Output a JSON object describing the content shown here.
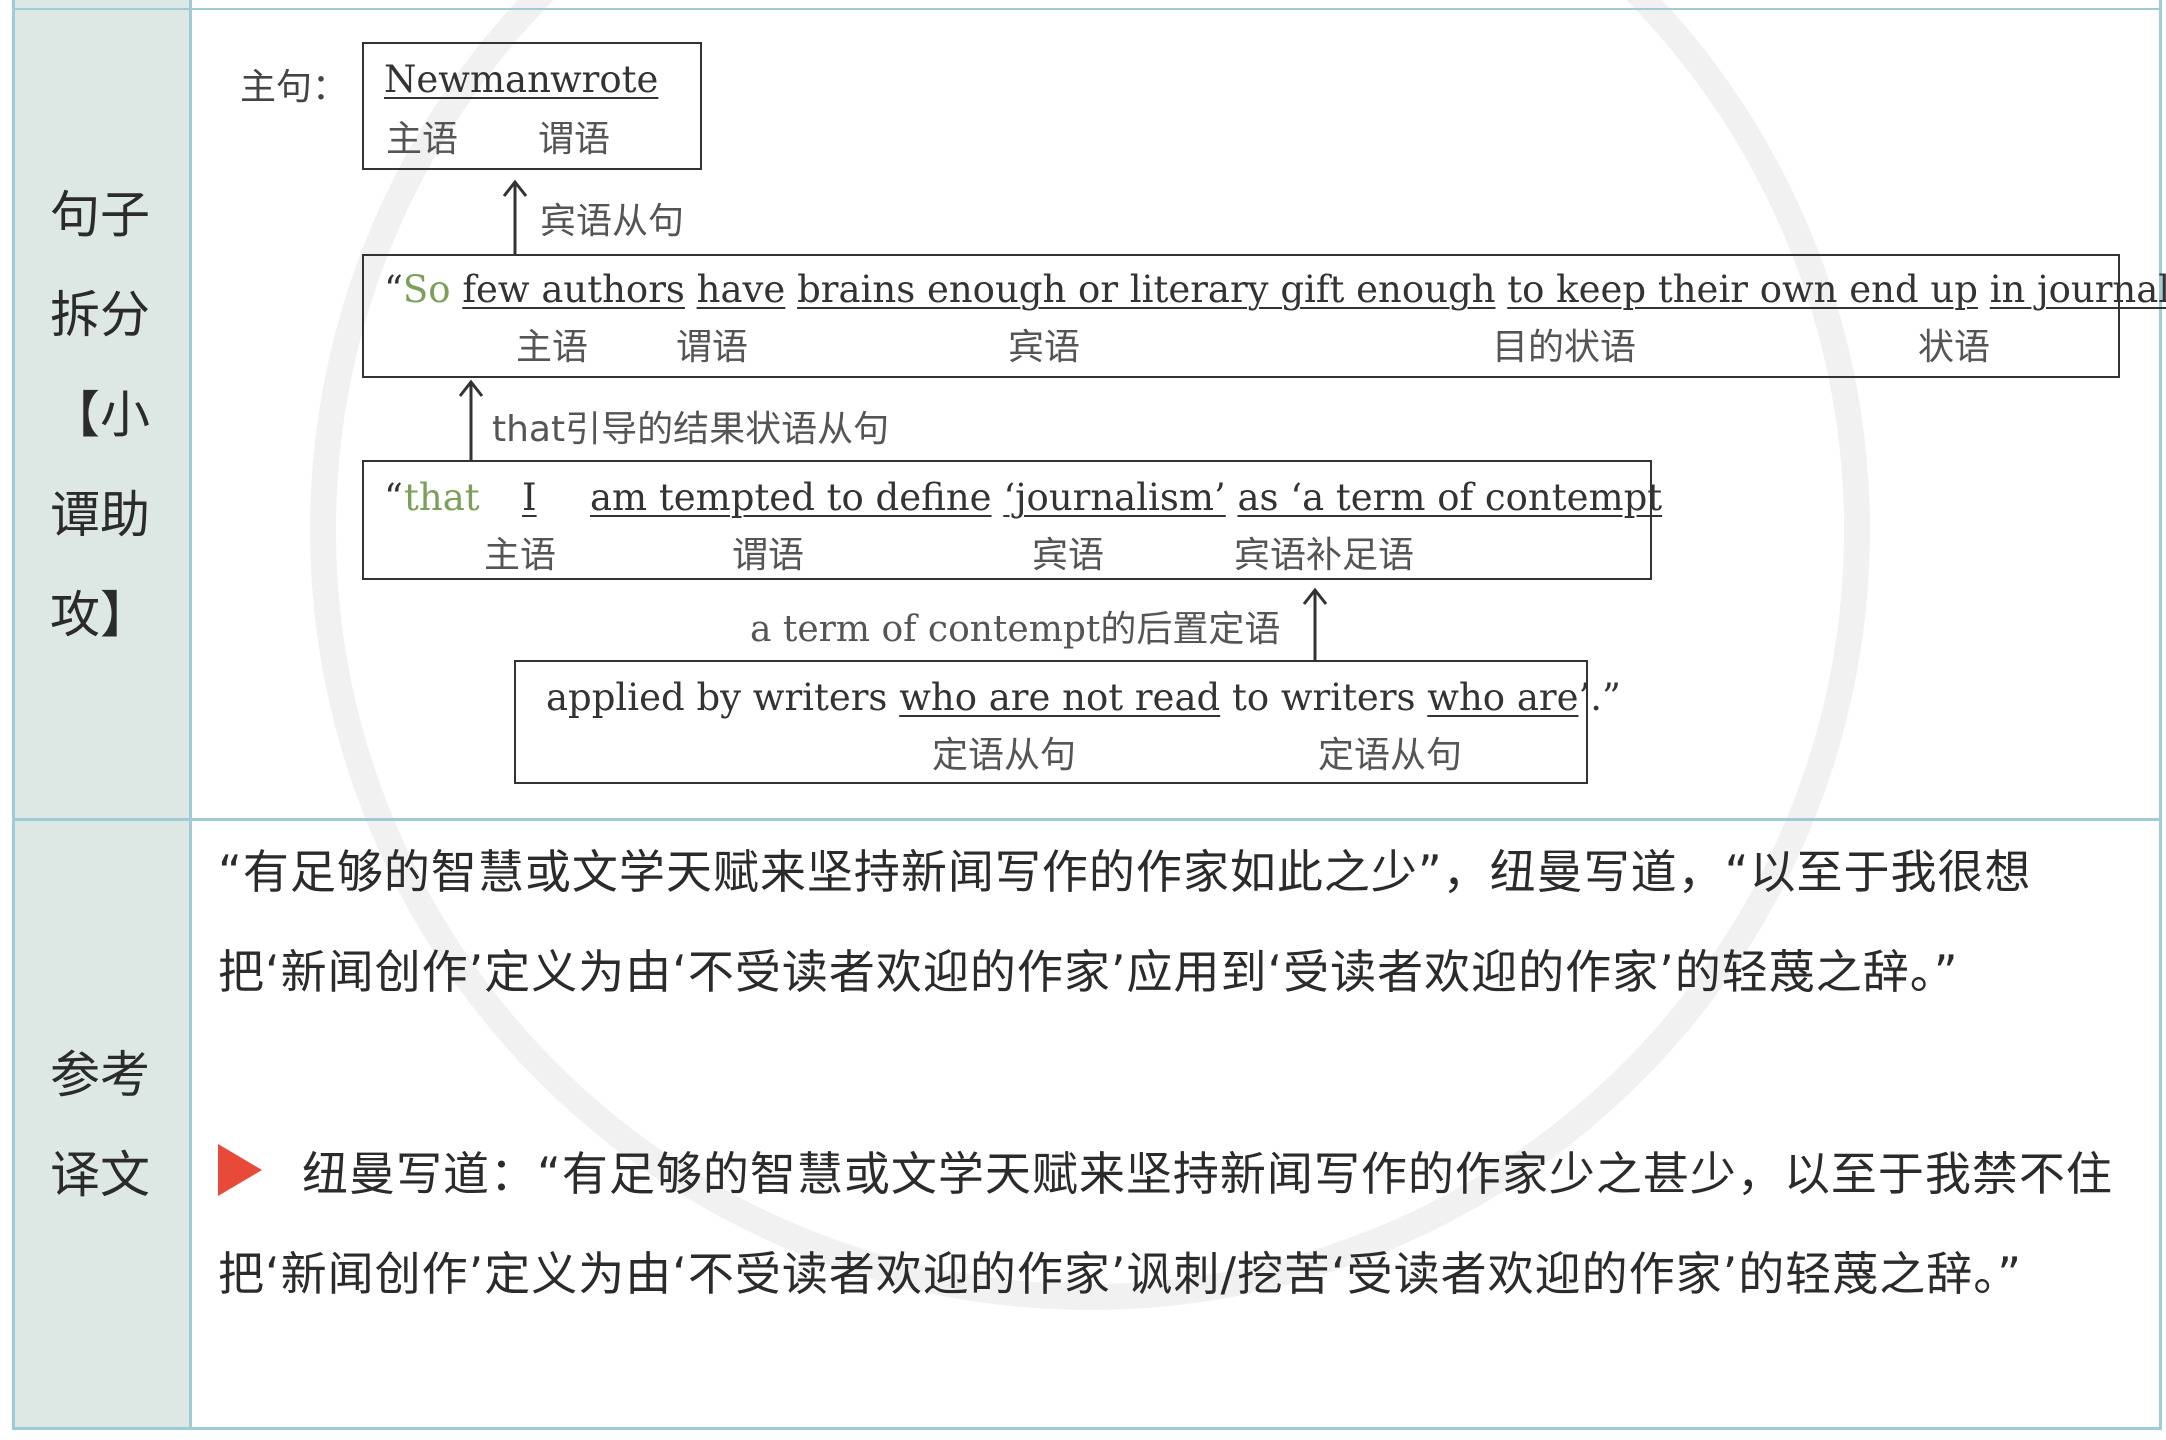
{
  "labels": {
    "analysis": [
      "句子",
      "拆分",
      "【小",
      "谭助",
      "攻】"
    ],
    "translation": [
      "参考",
      "译文"
    ]
  },
  "main_clause": {
    "prefix": "主句：",
    "subject": "Newman",
    "verb": "wrote",
    "subject_tag": "主语",
    "verb_tag": "谓语"
  },
  "arrow1_label": "宾语从句",
  "clause1": {
    "open_quote": "“",
    "so": "So",
    "subject": "few authors",
    "verb": "have",
    "object": "brains enough or literary gift enough",
    "purpose": "to keep their own end up",
    "adverbial": "in  journalism",
    "close": ",”",
    "tags": [
      "主语",
      "谓语",
      "宾语",
      "目的状语",
      "状语"
    ]
  },
  "arrow2_label": "that引导的结果状语从句",
  "clause2": {
    "open_quote": "“",
    "that": "that",
    "subject": "I",
    "verb": "am tempted to define",
    "object": "‘journalism’",
    "complement": "as ‘a term of contempt",
    "tags": [
      "主语",
      "谓语",
      "宾语",
      "宾语补足语"
    ]
  },
  "arrow3_label": "a term of contempt的后置定语",
  "clause3": {
    "t1": "applied by writers",
    "rel1": "who are not read",
    "t2": "to writers",
    "rel2": "who are",
    "end": "’.”",
    "tags": [
      "定语从句",
      "定语从句"
    ]
  },
  "translation": {
    "p1": "“有足够的智慧或文学天赋来坚持新闻写作的作家如此之少”，纽曼写道，“以至于我很想把‘新闻创作’定义为由‘不受读者欢迎的作家’应用到‘受读者欢迎的作家’的轻蔑之辞。”",
    "p2": "纽曼写道：“有足够的智慧或文学天赋来坚持新闻写作的作家少之甚少，以至于我禁不住把‘新闻创作’定义为由‘不受读者欢迎的作家’讽刺/挖苦‘受读者欢迎的作家’的轻蔑之辞。”"
  },
  "colors": {
    "border": "#9fcbd6",
    "label_bg": "#dde8e4",
    "accent_green": "#7ba05b",
    "marker_red": "#e84a3a"
  }
}
